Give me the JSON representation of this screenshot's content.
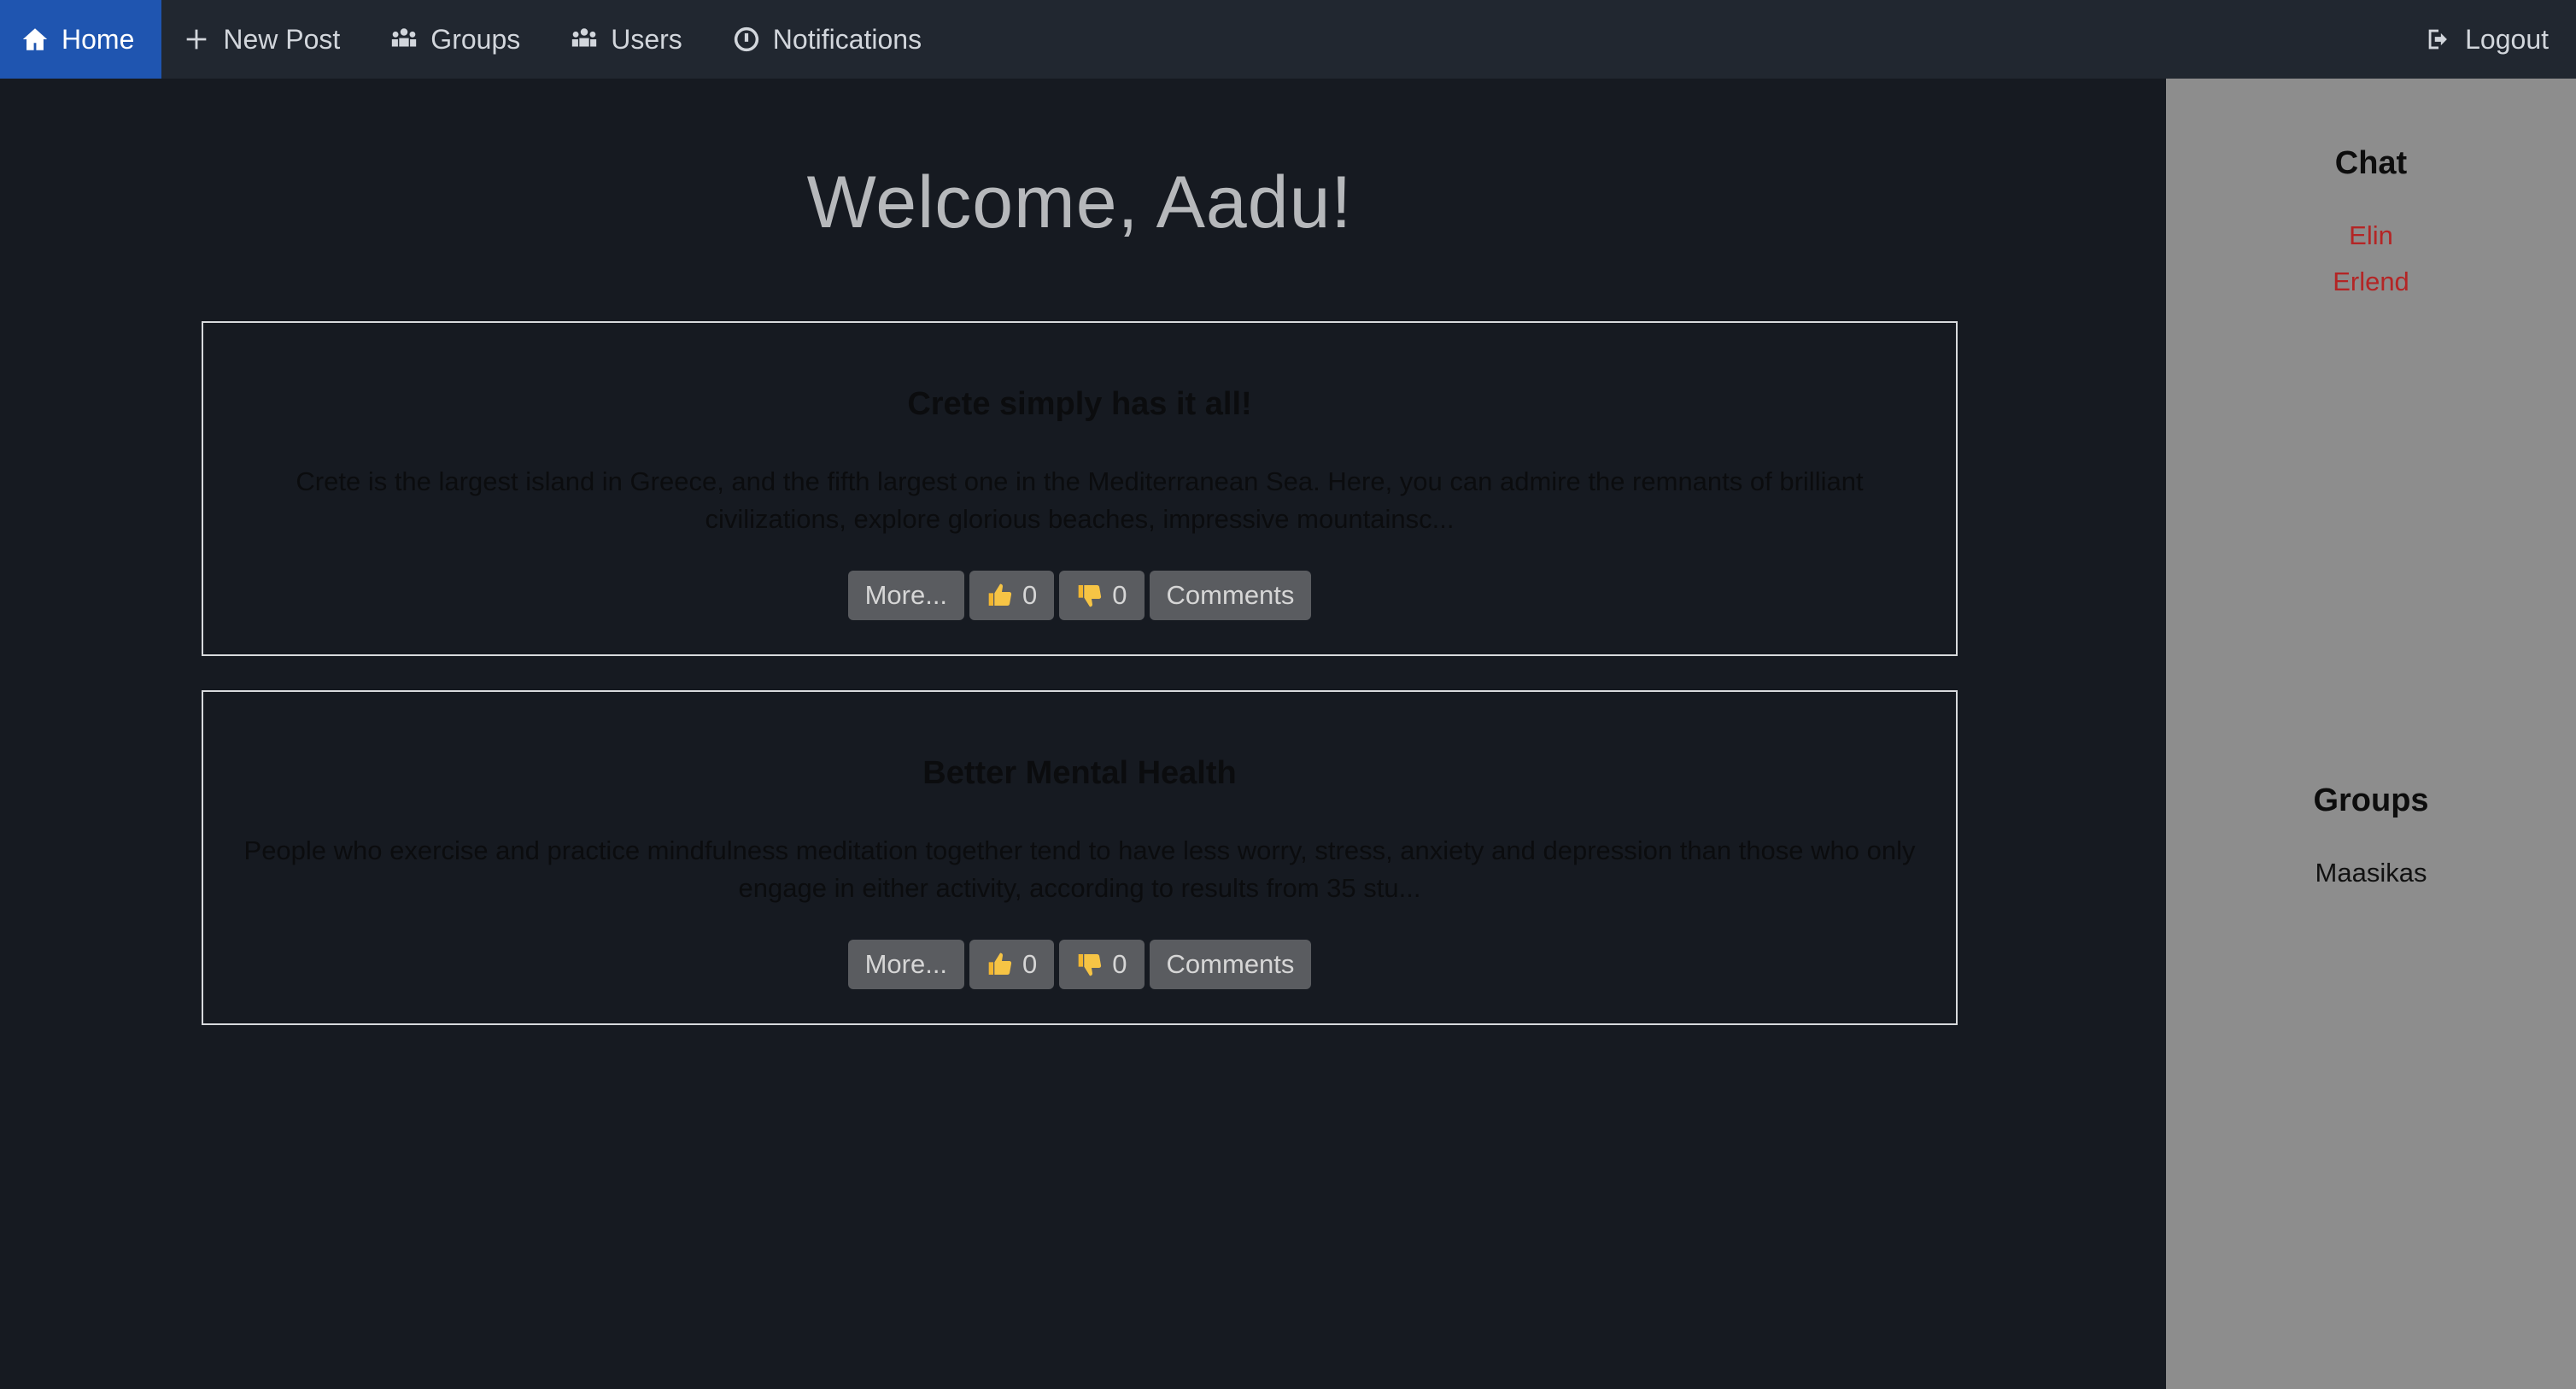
{
  "nav": {
    "home": {
      "label": "Home",
      "icon": "home-icon"
    },
    "new_post": {
      "label": "New Post",
      "icon": "plus-icon"
    },
    "groups": {
      "label": "Groups",
      "icon": "users-group-icon"
    },
    "users": {
      "label": "Users",
      "icon": "users-group-icon"
    },
    "notifications": {
      "label": "Notifications",
      "icon": "alert-icon"
    },
    "logout": {
      "label": "Logout",
      "icon": "logout-icon"
    }
  },
  "main": {
    "welcome": "Welcome, Aadu!",
    "posts": [
      {
        "title": "Crete simply has it all!",
        "excerpt": "Crete is the largest island in Greece, and the fifth largest one in the Mediterranean Sea. Here, you can admire the remnants of brilliant civilizations, explore glorious beaches, impressive mountainsc...",
        "more_label": "More...",
        "likes": "0",
        "dislikes": "0",
        "comments_label": "Comments"
      },
      {
        "title": "Better Mental Health",
        "excerpt": "People who exercise and practice mindfulness meditation together tend to have less worry, stress, anxiety and depression than those who only engage in either activity, according to results from 35 stu...",
        "more_label": "More...",
        "likes": "0",
        "dislikes": "0",
        "comments_label": "Comments"
      }
    ]
  },
  "sidebar": {
    "chat_heading": "Chat",
    "chat_users": [
      "Elin",
      "Erlend"
    ],
    "groups_heading": "Groups",
    "groups": [
      "Maasikas"
    ]
  },
  "colors": {
    "navbar_bg": "#212730",
    "nav_active_bg": "#1f55b0",
    "page_bg": "#161a21",
    "sidebar_bg": "#8d8d8d",
    "chat_link": "#b42525",
    "button_bg": "#5a5c60"
  }
}
